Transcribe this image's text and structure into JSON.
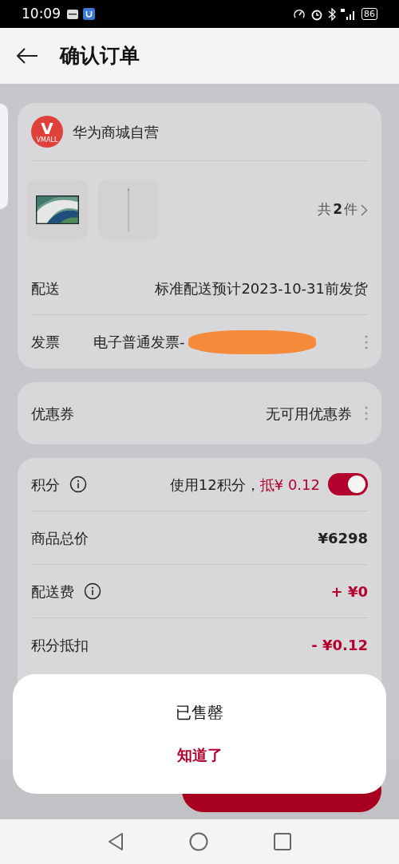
{
  "status_bar": {
    "time": "10:09",
    "battery": "86"
  },
  "header": {
    "title": "确认订单"
  },
  "store": {
    "name": "华为商城自营",
    "logo_letter": "V",
    "logo_caption": "VMALL",
    "count_prefix": "共",
    "count": "2",
    "count_suffix": "件"
  },
  "order_rows": [
    {
      "label": "配送",
      "value": "标准配送预计2023-10-31前发货",
      "redacted": false,
      "more": false
    },
    {
      "label": "发票",
      "value": "电子普通发票-",
      "redacted": true,
      "more": true
    }
  ],
  "coupon": {
    "label": "优惠券",
    "value": "无可用优惠券",
    "more": true
  },
  "price_rows": [
    {
      "kind": "toggle",
      "label": "积分",
      "info": true,
      "note": "使用12积分，",
      "value": "抵¥ 0.12",
      "on": true,
      "highlight": true
    },
    {
      "kind": "amount",
      "label": "商品总价",
      "info": false,
      "value": "¥6298",
      "highlight": false
    },
    {
      "kind": "amount",
      "label": "配送费",
      "info": true,
      "value": "+ ¥0",
      "highlight": true
    },
    {
      "kind": "amount",
      "label": "积分抵扣",
      "info": false,
      "value": "- ¥0.12",
      "highlight": true
    }
  ],
  "dialog": {
    "message": "已售罄",
    "button": "知道了"
  }
}
